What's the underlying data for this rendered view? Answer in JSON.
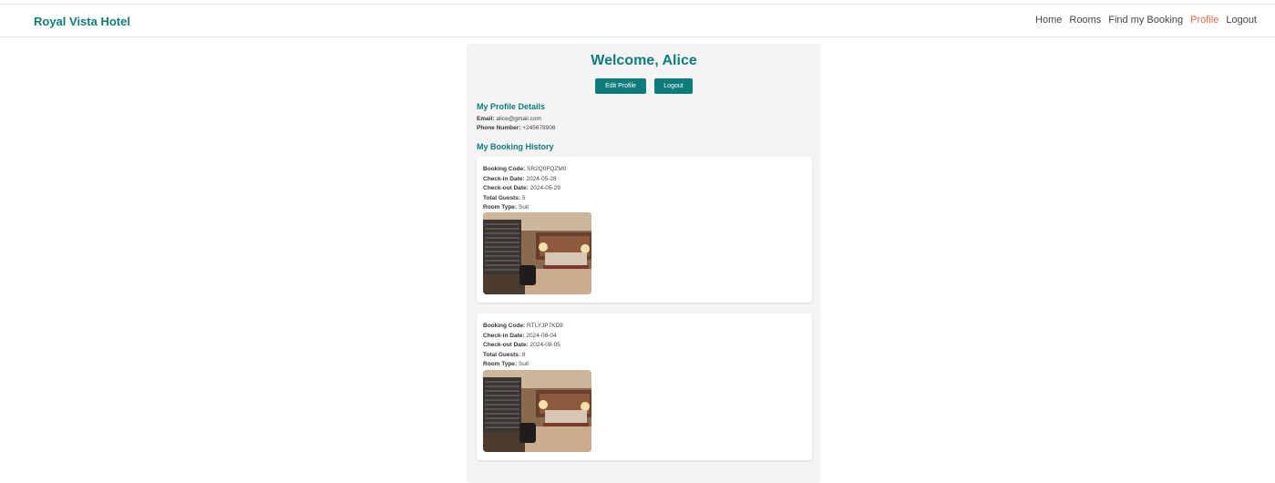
{
  "header": {
    "brand": "Royal Vista Hotel",
    "nav": [
      {
        "label": "Home",
        "active": false
      },
      {
        "label": "Rooms",
        "active": false
      },
      {
        "label": "Find my Booking",
        "active": false
      },
      {
        "label": "Profile",
        "active": true
      },
      {
        "label": "Logout",
        "active": false
      }
    ]
  },
  "profile": {
    "welcome": "Welcome, Alice",
    "edit_label": "Edit Profile",
    "logout_label": "Logout",
    "details_title": "My Profile Details",
    "email_label": "Email:",
    "email": "alice@gmail.com",
    "phone_label": "Phone Number:",
    "phone": "+245678906",
    "history_title": "My Booking History"
  },
  "labels": {
    "code": "Booking Code:",
    "checkin": "Check-in Date:",
    "checkout": "Check-out Date:",
    "guests": "Total Guests:",
    "room": "Room Type:"
  },
  "bookings": [
    {
      "code": "SR2Q0FQZM0",
      "checkin": "2024-05-28",
      "checkout": "2024-05-29",
      "guests": "5",
      "room": "Suit"
    },
    {
      "code": "RTLYJP7KD8",
      "checkin": "2024-08-04",
      "checkout": "2024-08-05",
      "guests": "8",
      "room": "Suit"
    }
  ],
  "colors": {
    "accent": "#0e7c7b",
    "nav_active": "#e36a45"
  }
}
